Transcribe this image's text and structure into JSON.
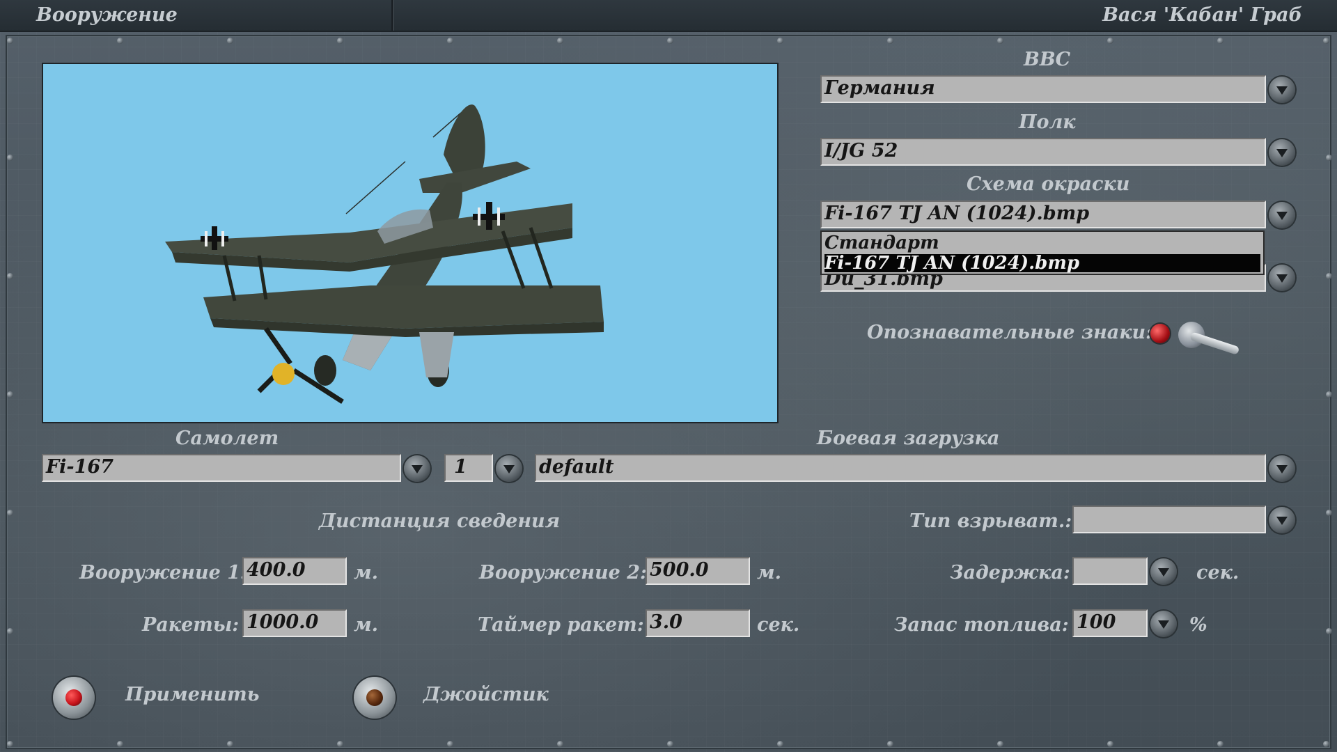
{
  "header": {
    "title": "Вооружение",
    "user": "Вася 'Кабан' Граб"
  },
  "airforce": {
    "label": "ВВС",
    "value": "Германия"
  },
  "regiment": {
    "label": "Полк",
    "value": "I/JG 52"
  },
  "skin": {
    "label": "Схема окраски",
    "value": "Fi-167 TJ AN (1024).bmp",
    "options": [
      "Стандарт",
      "Fi-167 TJ AN (1024).bmp"
    ],
    "selected_index": 1
  },
  "hidden_field": {
    "value": "Du_31.bmp"
  },
  "markings": {
    "label": "Опознавательные знаки:"
  },
  "aircraft": {
    "label": "Самолет",
    "value": "Fi-167",
    "count": "1"
  },
  "loadout": {
    "label": "Боевая загрузка",
    "value": "default"
  },
  "convergence": {
    "label": "Дистанция сведения"
  },
  "weapon1": {
    "label": "Вооружение 1:",
    "value": "400.0",
    "unit": "м."
  },
  "weapon2": {
    "label": "Вооружение 2:",
    "value": "500.0",
    "unit": "м."
  },
  "rockets": {
    "label": "Ракеты:",
    "value": "1000.0",
    "unit": "м."
  },
  "rocket_timer": {
    "label": "Таймер ракет:",
    "value": "3.0",
    "unit": "сек."
  },
  "fuze": {
    "label": "Тип взрыват.:",
    "value": ""
  },
  "delay": {
    "label": "Задержка:",
    "value": "",
    "unit": "сек."
  },
  "fuel": {
    "label": "Запас топлива:",
    "value": "100",
    "unit": "%"
  },
  "buttons": {
    "apply": "Применить",
    "joystick": "Джойстик"
  },
  "colors": {
    "preview_sky": "#7ec8ea",
    "field_bg": "#b5b5b5",
    "selected_bg": "#050505",
    "apply_led": "#c8141c",
    "joystick_led": "#5a2a0e"
  }
}
